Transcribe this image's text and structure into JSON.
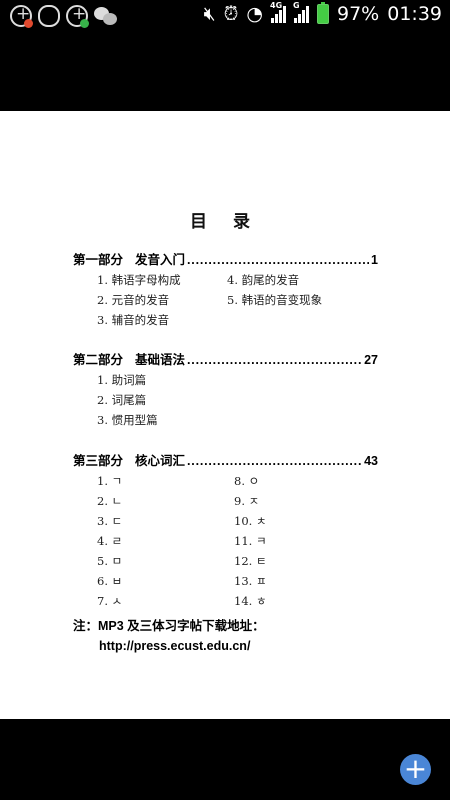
{
  "status_bar": {
    "battery_percent": "97%",
    "time": "01:39",
    "network_4g": "4G",
    "network_g": "G",
    "colors": {
      "badge_red": "#e04a2f",
      "badge_green": "#38b34a",
      "battery": "#44cc44"
    }
  },
  "document": {
    "title": "目 录",
    "sections": [
      {
        "part": "第一部分",
        "name": "发音入门",
        "page": "1",
        "items": [
          "1. 韩语字母构成",
          "2. 元音的发音",
          "3. 辅音的发音",
          "4. 韵尾的发音",
          "5. 韩语的音变现象"
        ]
      },
      {
        "part": "第二部分",
        "name": "基础语法",
        "page": "27",
        "items": [
          "1. 助词篇",
          "2. 词尾篇",
          "3. 惯用型篇"
        ]
      },
      {
        "part": "第三部分",
        "name": "核心词汇",
        "page": "43",
        "items": [
          "1. ㄱ",
          "2. ㄴ",
          "3. ㄷ",
          "4. ㄹ",
          "5. ㅁ",
          "6. ㅂ",
          "7. ㅅ",
          "8. ㅇ",
          "9. ㅈ",
          "10. ㅊ",
          "11. ㅋ",
          "12. ㅌ",
          "13. ㅍ",
          "14. ㅎ"
        ]
      }
    ],
    "note": {
      "line1": "注：MP3 及三体习字帖下载地址：",
      "url": "http://press.ecust.edu.cn/"
    }
  },
  "fab": {
    "label": "+",
    "color": "#4a86d6"
  }
}
